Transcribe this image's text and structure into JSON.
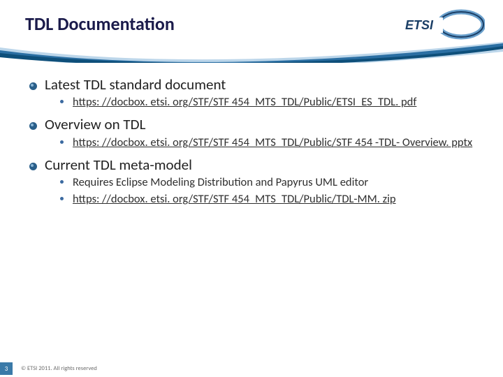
{
  "title": "TDL Documentation",
  "logo_text": "ETSI",
  "sections": [
    {
      "heading": "Latest TDL standard document",
      "items": [
        {
          "text": "https: //docbox. etsi. org/STF/STF 454_MTS_TDL/Public/ETSI_ES_TDL. pdf",
          "link": true
        }
      ]
    },
    {
      "heading": "Overview on TDL",
      "items": [
        {
          "text": "https: //docbox. etsi. org/STF/STF 454_MTS_TDL/Public/STF 454 -TDL- Overview. pptx",
          "link": true
        }
      ]
    },
    {
      "heading": "Current TDL meta-model",
      "items": [
        {
          "text": "Requires Eclipse Modeling Distribution and Papyrus UML editor",
          "link": false
        },
        {
          "text": "https: //docbox. etsi. org/STF/STF 454_MTS_TDL/Public/TDL-MM. zip",
          "link": true
        }
      ]
    }
  ],
  "footer": {
    "slide_number": "3",
    "copyright": "© ETSI 2011. All rights reserved"
  },
  "colors": {
    "title": "#1b1b4b",
    "accent": "#3a7aa8",
    "bullet_fill": "#2a5f8a",
    "swoosh_blue": "#2b6fa3",
    "swoosh_dark": "#0e4f7a"
  }
}
